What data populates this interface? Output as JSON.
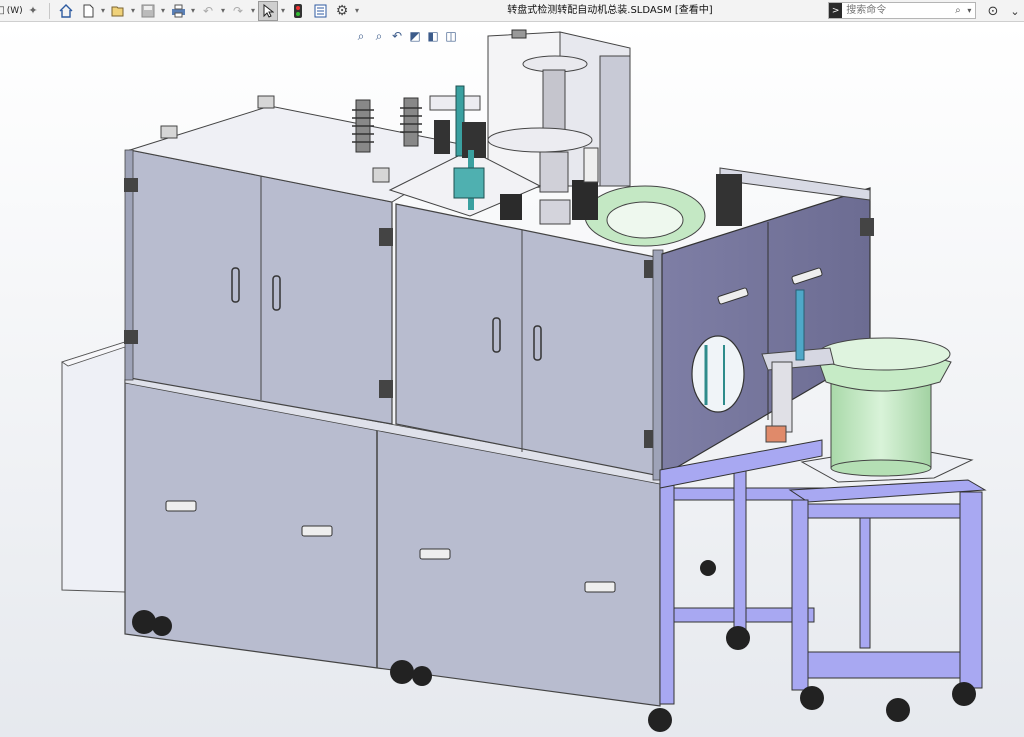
{
  "toolbar": {
    "menu_label": "(W)",
    "items": [
      "home-icon",
      "new-icon",
      "open-icon",
      "save-icon",
      "print-icon",
      "undo-icon",
      "redo-icon",
      "select-icon",
      "rebuild-icon",
      "file-properties-icon",
      "options-icon"
    ]
  },
  "document": {
    "title": "转盘式检测转配自动机总装.SLDASM [查看中]"
  },
  "search": {
    "placeholder": "搜索命令"
  },
  "view_toolbar": [
    "zoom-to-fit-icon",
    "zoom-area-icon",
    "previous-view-icon",
    "section-view-icon",
    "view-orientation-icon",
    "display-style-icon"
  ],
  "colors": {
    "cabinet": "#b8bccf",
    "frame": "#a8a8f2",
    "feeder_bowl": "#c4e8c4",
    "background_top": "#ffffff",
    "background_bottom": "#e6e9ee"
  }
}
